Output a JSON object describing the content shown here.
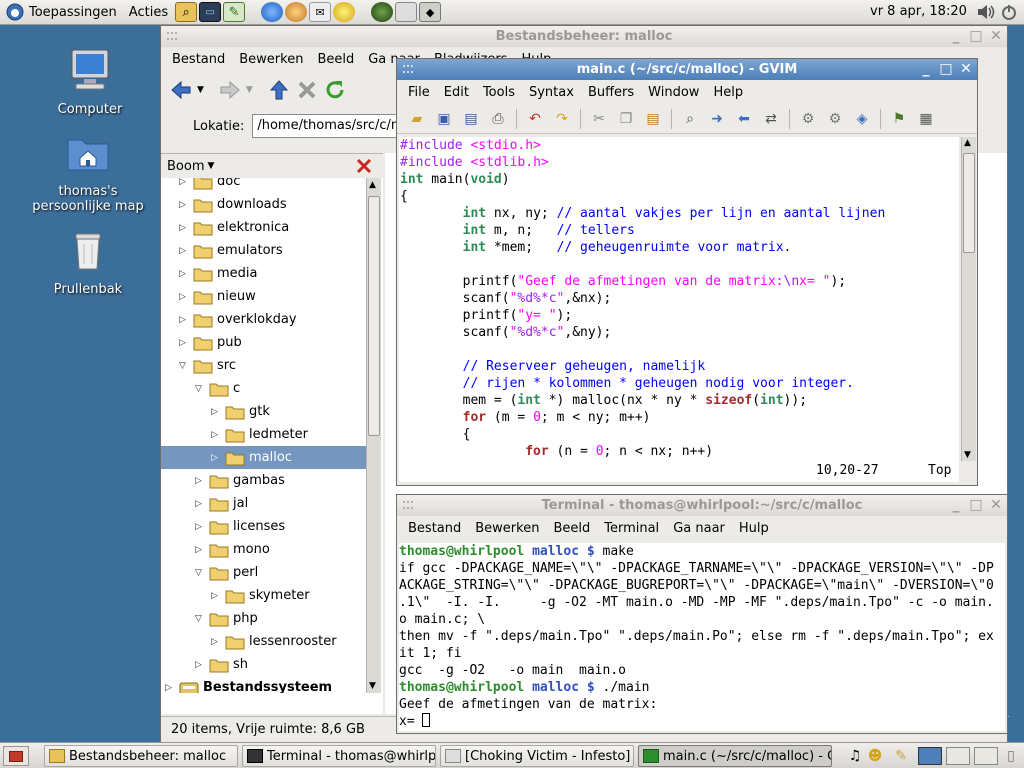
{
  "top_panel": {
    "applications_label": "Toepassingen",
    "actions_label": "Acties",
    "clock": "vr   8 apr, 18:20"
  },
  "desktop": {
    "icons": [
      {
        "label": "Computer"
      },
      {
        "label": "thomas's persoonlijke map"
      },
      {
        "label": "Prullenbak"
      }
    ]
  },
  "file_manager": {
    "title": "Bestandsbeheer: malloc",
    "menu": [
      "Bestand",
      "Bewerken",
      "Beeld",
      "Ga naar",
      "Bladwijzers",
      "Hulp"
    ],
    "location_label": "Lokatie:",
    "location_value": "/home/thomas/src/c/malloc",
    "sidebar_mode": "Boom",
    "tree": [
      {
        "name": "doc",
        "expanded": false
      },
      {
        "name": "downloads",
        "expanded": false
      },
      {
        "name": "elektronica",
        "expanded": false
      },
      {
        "name": "emulators",
        "expanded": false
      },
      {
        "name": "media",
        "expanded": false
      },
      {
        "name": "nieuw",
        "expanded": false
      },
      {
        "name": "overklokday",
        "expanded": false
      },
      {
        "name": "pub",
        "expanded": false
      },
      {
        "name": "src",
        "expanded": true
      },
      {
        "name": "c",
        "expanded": true
      },
      {
        "name": "gtk",
        "expanded": false
      },
      {
        "name": "ledmeter",
        "expanded": false
      },
      {
        "name": "malloc",
        "expanded": false,
        "selected": true
      },
      {
        "name": "gambas",
        "expanded": false
      },
      {
        "name": "jal",
        "expanded": false
      },
      {
        "name": "licenses",
        "expanded": false
      },
      {
        "name": "mono",
        "expanded": false
      },
      {
        "name": "perl",
        "expanded": true
      },
      {
        "name": "skymeter",
        "expanded": false
      },
      {
        "name": "php",
        "expanded": true
      },
      {
        "name": "lessenrooster",
        "expanded": false
      },
      {
        "name": "sh",
        "expanded": false
      },
      {
        "name": "Bestandssysteem",
        "expanded": false,
        "bold": true
      }
    ],
    "status": "20 items, Vrije ruimte: 8,6 GB"
  },
  "gvim": {
    "title": "main.c (~/src/c/malloc) - GVIM",
    "menu": [
      "File",
      "Edit",
      "Tools",
      "Syntax",
      "Buffers",
      "Window",
      "Help"
    ],
    "ruler_position": "10,20-27",
    "ruler_percent": "Top",
    "code_lines": [
      [
        {
          "t": "#include ",
          "c": "pp"
        },
        {
          "t": "<stdio.h>",
          "c": "str"
        }
      ],
      [
        {
          "t": "#include ",
          "c": "pp"
        },
        {
          "t": "<stdlib.h>",
          "c": "str"
        }
      ],
      [
        {
          "t": "int",
          "c": "ty"
        },
        {
          "t": " main(",
          "c": ""
        },
        {
          "t": "void",
          "c": "ty"
        },
        {
          "t": ")",
          "c": ""
        }
      ],
      [
        {
          "t": "{",
          "c": ""
        }
      ],
      [
        {
          "t": "        ",
          "c": ""
        },
        {
          "t": "int",
          "c": "ty"
        },
        {
          "t": " nx, ny; ",
          "c": ""
        },
        {
          "t": "// aantal vakjes per lijn en aantal lijnen",
          "c": "cm"
        }
      ],
      [
        {
          "t": "        ",
          "c": ""
        },
        {
          "t": "int",
          "c": "ty"
        },
        {
          "t": " m, n;   ",
          "c": ""
        },
        {
          "t": "// tellers",
          "c": "cm"
        }
      ],
      [
        {
          "t": "        ",
          "c": ""
        },
        {
          "t": "int",
          "c": "ty"
        },
        {
          "t": " *mem;   ",
          "c": ""
        },
        {
          "t": "// geheugenruimte voor matrix.",
          "c": "cm"
        }
      ],
      [
        {
          "t": "",
          "c": ""
        }
      ],
      [
        {
          "t": "        printf(",
          "c": ""
        },
        {
          "t": "\"Geef de afmetingen van de matrix:",
          "c": "str"
        },
        {
          "t": "\\n",
          "c": "pp"
        },
        {
          "t": "x= \"",
          "c": "str"
        },
        {
          "t": ");",
          "c": ""
        }
      ],
      [
        {
          "t": "        scanf(",
          "c": ""
        },
        {
          "t": "\"",
          "c": "str"
        },
        {
          "t": "%d%*c",
          "c": "pp"
        },
        {
          "t": "\"",
          "c": "str"
        },
        {
          "t": ",&nx);",
          "c": ""
        }
      ],
      [
        {
          "t": "        printf(",
          "c": ""
        },
        {
          "t": "\"y= \"",
          "c": "str"
        },
        {
          "t": ");",
          "c": ""
        }
      ],
      [
        {
          "t": "        scanf(",
          "c": ""
        },
        {
          "t": "\"",
          "c": "str"
        },
        {
          "t": "%d%*c",
          "c": "pp"
        },
        {
          "t": "\"",
          "c": "str"
        },
        {
          "t": ",&ny);",
          "c": ""
        }
      ],
      [
        {
          "t": "",
          "c": ""
        }
      ],
      [
        {
          "t": "        ",
          "c": ""
        },
        {
          "t": "// Reserveer geheugen, namelijk",
          "c": "cm"
        }
      ],
      [
        {
          "t": "        ",
          "c": ""
        },
        {
          "t": "// rijen * kolommen * geheugen nodig voor integer.",
          "c": "cm"
        }
      ],
      [
        {
          "t": "        mem = (",
          "c": ""
        },
        {
          "t": "int",
          "c": "ty"
        },
        {
          "t": " *) malloc(nx * ny * ",
          "c": ""
        },
        {
          "t": "sizeof",
          "c": "kw"
        },
        {
          "t": "(",
          "c": ""
        },
        {
          "t": "int",
          "c": "ty"
        },
        {
          "t": "));",
          "c": ""
        }
      ],
      [
        {
          "t": "        ",
          "c": ""
        },
        {
          "t": "for",
          "c": "kw"
        },
        {
          "t": " (m = ",
          "c": ""
        },
        {
          "t": "0",
          "c": "num"
        },
        {
          "t": "; m < ny; m++)",
          "c": ""
        }
      ],
      [
        {
          "t": "        {",
          "c": ""
        }
      ],
      [
        {
          "t": "                ",
          "c": ""
        },
        {
          "t": "for",
          "c": "kw"
        },
        {
          "t": " (n = ",
          "c": ""
        },
        {
          "t": "0",
          "c": "num"
        },
        {
          "t": "; n < nx; n++)",
          "c": ""
        }
      ]
    ]
  },
  "terminal": {
    "title": "Terminal - thomas@whirlpool:~/src/c/malloc",
    "menu": [
      "Bestand",
      "Bewerken",
      "Beeld",
      "Terminal",
      "Ga naar",
      "Hulp"
    ],
    "lines": [
      {
        "type": "prompt",
        "user": "thomas@whirlpool",
        "dir": "malloc",
        "sym": "$",
        "cmd": " make"
      },
      {
        "type": "text",
        "text": "if gcc -DPACKAGE_NAME=\\\"\\\" -DPACKAGE_TARNAME=\\\"\\\" -DPACKAGE_VERSION=\\\"\\\" -DP"
      },
      {
        "type": "text",
        "text": "ACKAGE_STRING=\\\"\\\" -DPACKAGE_BUGREPORT=\\\"\\\" -DPACKAGE=\\\"main\\\" -DVERSION=\\\"0"
      },
      {
        "type": "text",
        "text": ".1\\\"  -I. -I.     -g -O2 -MT main.o -MD -MP -MF \".deps/main.Tpo\" -c -o main."
      },
      {
        "type": "text",
        "text": "o main.c; \\"
      },
      {
        "type": "text",
        "text": "then mv -f \".deps/main.Tpo\" \".deps/main.Po\"; else rm -f \".deps/main.Tpo\"; ex"
      },
      {
        "type": "text",
        "text": "it 1; fi"
      },
      {
        "type": "text",
        "text": "gcc  -g -O2   -o main  main.o"
      },
      {
        "type": "prompt",
        "user": "thomas@whirlpool",
        "dir": "malloc",
        "sym": "$",
        "cmd": " ./main"
      },
      {
        "type": "text",
        "text": "Geef de afmetingen van de matrix:"
      },
      {
        "type": "input",
        "text": "x= "
      }
    ]
  },
  "taskbar": {
    "tasks": [
      {
        "label": "Bestandsbeheer: malloc"
      },
      {
        "label": "Terminal - thomas@whirlpo"
      },
      {
        "label": "[Choking Victim - Infesto]"
      },
      {
        "label": "main.c (~/src/c/malloc) - G"
      }
    ]
  },
  "colors": {
    "desktop_bg": "#3c6e9a",
    "title_active": "#5a8bc4",
    "selection": "#7597bf",
    "prompt_user": "#2e8b2e",
    "prompt_dir": "#3050c0"
  }
}
